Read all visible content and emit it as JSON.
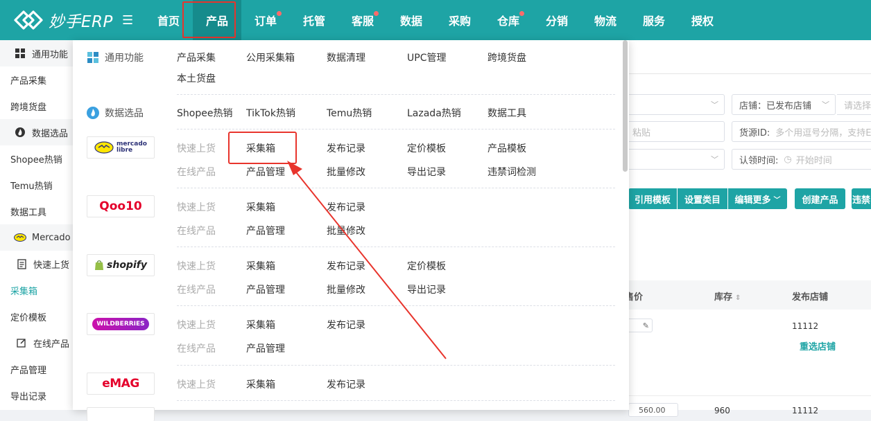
{
  "app": {
    "name": "妙手ERP"
  },
  "nav": {
    "items": [
      {
        "label": "首页",
        "dot": false
      },
      {
        "label": "产品",
        "dot": false,
        "active": true
      },
      {
        "label": "订单",
        "dot": true
      },
      {
        "label": "托管",
        "dot": false
      },
      {
        "label": "客服",
        "dot": true
      },
      {
        "label": "数据",
        "dot": false
      },
      {
        "label": "采购",
        "dot": false
      },
      {
        "label": "仓库",
        "dot": true
      },
      {
        "label": "分销",
        "dot": false
      },
      {
        "label": "物流",
        "dot": false
      },
      {
        "label": "服务",
        "dot": false
      },
      {
        "label": "授权",
        "dot": false
      }
    ]
  },
  "sidebar": {
    "items": [
      {
        "label": "通用功能",
        "type": "group",
        "icon": "grid-icon"
      },
      {
        "label": "产品采集",
        "type": "item"
      },
      {
        "label": "跨境货盘",
        "type": "item"
      },
      {
        "label": "数据选品",
        "type": "group",
        "icon": "flame-icon"
      },
      {
        "label": "Shopee热销",
        "type": "item"
      },
      {
        "label": "Temu热销",
        "type": "item"
      },
      {
        "label": "数据工具",
        "type": "item"
      },
      {
        "label": "Mercado Libre",
        "type": "group",
        "icon": "mercado-icon"
      },
      {
        "label": "快速上货",
        "type": "sub",
        "icon": "document-icon"
      },
      {
        "label": "采集箱",
        "type": "item",
        "active": true
      },
      {
        "label": "定价模板",
        "type": "item"
      },
      {
        "label": "在线产品",
        "type": "sub",
        "icon": "edit-icon"
      },
      {
        "label": "产品管理",
        "type": "item"
      },
      {
        "label": "导出记录",
        "type": "item"
      }
    ]
  },
  "content": {
    "store_label": "店铺：已发布店铺",
    "select_placeholder": "请选择",
    "paste_placeholder": "粘贴",
    "source_label": "货源ID:",
    "source_placeholder": "多个用逗号分隔，支持E",
    "claim_label": "认领时间:",
    "claim_placeholder": "开始时间",
    "buttons": {
      "use_template": "引用模板",
      "set_category": "设置类目",
      "edit_more": "编辑更多",
      "create_product": "创建产品",
      "violation": "违禁"
    },
    "table": {
      "headers": {
        "price": "售价",
        "stock": "库存",
        "store": "发布店铺"
      },
      "row1": {
        "store": "11112",
        "reselect": "重选店铺"
      },
      "row2": {
        "price": "560.00",
        "stock": "960",
        "store": "11112"
      }
    }
  },
  "dropdown": {
    "general": {
      "label": "通用功能",
      "links": [
        "产品采集",
        "公用采集箱",
        "数据清理",
        "UPC管理",
        "跨境货盘",
        "本土货盘"
      ]
    },
    "data": {
      "label": "数据选品",
      "links": [
        "Shopee热销",
        "TikTok热销",
        "Temu热销",
        "Lazada热销",
        "数据工具"
      ]
    },
    "quick_label": "快速上货",
    "online_label": "在线产品",
    "platforms": {
      "mercado": {
        "logo": "mercado libre",
        "quick": [
          "采集箱",
          "发布记录",
          "定价模板",
          "产品模板"
        ],
        "online": [
          "产品管理",
          "批量修改",
          "导出记录",
          "违禁词检测"
        ]
      },
      "qoo10": {
        "logo": "Qoo10",
        "quick": [
          "采集箱",
          "发布记录"
        ],
        "online": [
          "产品管理",
          "批量修改"
        ]
      },
      "shopify": {
        "logo": "shopify",
        "quick": [
          "采集箱",
          "发布记录",
          "定价模板"
        ],
        "online": [
          "产品管理",
          "批量修改",
          "导出记录"
        ]
      },
      "wildberries": {
        "logo": "WILDBERRIES",
        "quick": [
          "采集箱",
          "发布记录"
        ],
        "online": [
          "产品管理"
        ]
      },
      "emag": {
        "logo": "eMAG",
        "quick": [
          "采集箱",
          "发布记录"
        ]
      }
    }
  },
  "colors": {
    "brand": "#1ea4a5",
    "highlight": "#e8342c"
  }
}
